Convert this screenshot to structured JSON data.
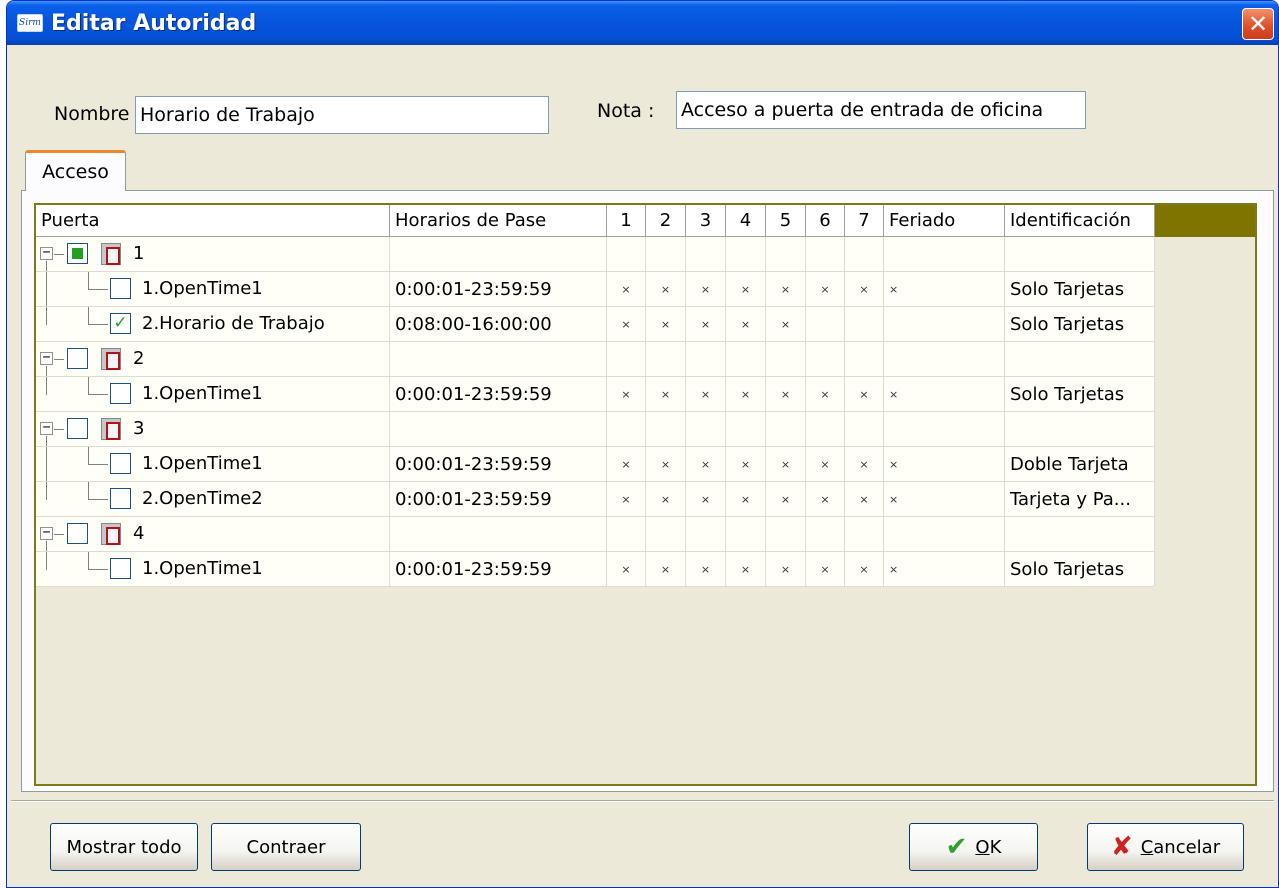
{
  "window": {
    "title": "Editar Autoridad",
    "close_glyph": "✕",
    "app_icon_text": "Sirm"
  },
  "form": {
    "name_label": "Nombre",
    "name_value": "Horario de Trabajo",
    "note_label": "Nota :",
    "note_value": "Acceso a puerta de entrada de oficina"
  },
  "tabs": [
    {
      "label": "Acceso",
      "active": true
    }
  ],
  "grid": {
    "headers": [
      "Puerta",
      "Horarios de Pase",
      "1",
      "2",
      "3",
      "4",
      "5",
      "6",
      "7",
      "Feriado",
      "Identificación"
    ],
    "rows": [
      {
        "level": 0,
        "label": "1",
        "check": "partial",
        "expanded": true,
        "time": "",
        "days": [
          "",
          "",
          "",
          "",
          "",
          "",
          ""
        ],
        "holiday": "",
        "id": ""
      },
      {
        "level": 1,
        "label": "1.OpenTime1",
        "check": "none",
        "time": "0:00:01-23:59:59",
        "days": [
          "×",
          "×",
          "×",
          "×",
          "×",
          "×",
          "×"
        ],
        "holiday": "×",
        "id": "Solo Tarjetas"
      },
      {
        "level": 1,
        "label": "2.Horario de Trabajo",
        "check": "checked",
        "time": "0:08:00-16:00:00",
        "days": [
          "×",
          "×",
          "×",
          "×",
          "×",
          "",
          ""
        ],
        "holiday": "",
        "id": "Solo Tarjetas"
      },
      {
        "level": 0,
        "label": "2",
        "check": "none",
        "expanded": true,
        "time": "",
        "days": [
          "",
          "",
          "",
          "",
          "",
          "",
          ""
        ],
        "holiday": "",
        "id": ""
      },
      {
        "level": 1,
        "label": "1.OpenTime1",
        "check": "none",
        "time": "0:00:01-23:59:59",
        "days": [
          "×",
          "×",
          "×",
          "×",
          "×",
          "×",
          "×"
        ],
        "holiday": "×",
        "id": "Solo Tarjetas"
      },
      {
        "level": 0,
        "label": "3",
        "check": "none",
        "expanded": true,
        "time": "",
        "days": [
          "",
          "",
          "",
          "",
          "",
          "",
          ""
        ],
        "holiday": "",
        "id": ""
      },
      {
        "level": 1,
        "label": "1.OpenTime1",
        "check": "none",
        "time": "0:00:01-23:59:59",
        "days": [
          "×",
          "×",
          "×",
          "×",
          "×",
          "×",
          "×"
        ],
        "holiday": "×",
        "id": "Doble Tarjeta"
      },
      {
        "level": 1,
        "label": "2.OpenTime2",
        "check": "none",
        "time": "0:00:01-23:59:59",
        "days": [
          "×",
          "×",
          "×",
          "×",
          "×",
          "×",
          "×"
        ],
        "holiday": "×",
        "id": "Tarjeta y Pa..."
      },
      {
        "level": 0,
        "label": "4",
        "check": "none",
        "expanded": true,
        "time": "",
        "days": [
          "",
          "",
          "",
          "",
          "",
          "",
          ""
        ],
        "holiday": "",
        "id": ""
      },
      {
        "level": 1,
        "label": "1.OpenTime1",
        "check": "none",
        "time": "0:00:01-23:59:59",
        "days": [
          "×",
          "×",
          "×",
          "×",
          "×",
          "×",
          "×"
        ],
        "holiday": "×",
        "id": "Solo Tarjetas"
      }
    ]
  },
  "buttons": {
    "show_all": "Mostrar todo",
    "collapse": "Contraer",
    "ok_accel": "O",
    "ok_rest": "K",
    "cancel_accel": "C",
    "cancel_rest": "ancelar"
  },
  "icons": {
    "ok": "check-icon",
    "cancel": "cross-icon",
    "door": "door-icon",
    "expander": "minus-icon"
  },
  "colors": {
    "title_bar": "#0654dc",
    "grid_header_fill": "#807400",
    "check_green": "#21a121",
    "cancel_red": "#d21f1f",
    "tab_accent": "#e68b2c"
  }
}
